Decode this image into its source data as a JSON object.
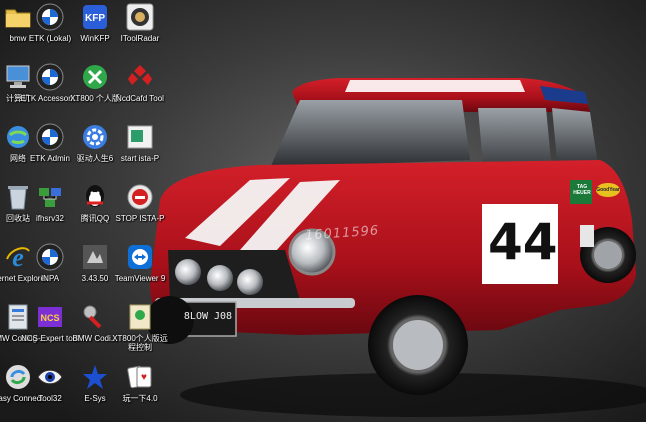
{
  "desktop": {
    "wallpaper": {
      "race_number": "44",
      "license_plate": "8LOW J08",
      "watermark": "16011596",
      "sponsor_badge": "TAG HEUER",
      "tyre_badge": "GoodYear"
    },
    "icons": [
      {
        "label": "bmw",
        "icon": "folder-icon"
      },
      {
        "label": "ETK (Lokal)",
        "icon": "bmw-logo-icon"
      },
      {
        "label": "WinKFP",
        "icon": "kfp-icon"
      },
      {
        "label": "IToolRadar",
        "icon": "radar-icon"
      },
      {
        "label": "计算机",
        "icon": "computer-icon"
      },
      {
        "label": "ETK Accessori...",
        "icon": "bmw-logo-icon"
      },
      {
        "label": "XT800 个人版",
        "icon": "xt800-icon"
      },
      {
        "label": "NcdCafd Tool",
        "icon": "ncd-icon"
      },
      {
        "label": "网络",
        "icon": "network-icon"
      },
      {
        "label": "ETK Admin",
        "icon": "bmw-logo-icon"
      },
      {
        "label": "驱动人生6",
        "icon": "gear-icon"
      },
      {
        "label": "start ista-P",
        "icon": "ista-icon"
      },
      {
        "label": "回收站",
        "icon": "recycle-bin-icon"
      },
      {
        "label": "ifhsrv32",
        "icon": "server-icon"
      },
      {
        "label": "腾讯QQ",
        "icon": "qq-icon"
      },
      {
        "label": "STOP ISTA-P",
        "icon": "stop-icon"
      },
      {
        "label": "Internet Explorer",
        "icon": "ie-icon"
      },
      {
        "label": "INPA",
        "icon": "bmw-logo-icon"
      },
      {
        "label": "3.43.50",
        "icon": "app-icon"
      },
      {
        "label": "TeamViewer 9",
        "icon": "teamviewer-icon"
      },
      {
        "label": "BMW Coding ...",
        "icon": "bmw-coding-icon"
      },
      {
        "label": "NCS-Expert tool",
        "icon": "ncs-icon"
      },
      {
        "label": "BMW Codi...",
        "icon": "tool-icon"
      },
      {
        "label": "XT800个人版远程控制",
        "icon": "xt800-remote-icon"
      },
      {
        "label": "Easy Connect",
        "icon": "easy-connect-icon"
      },
      {
        "label": "Tool32",
        "icon": "eye-icon"
      },
      {
        "label": "E-Sys",
        "icon": "esys-icon"
      },
      {
        "label": "玩一下4.0",
        "icon": "cards-icon"
      }
    ]
  }
}
